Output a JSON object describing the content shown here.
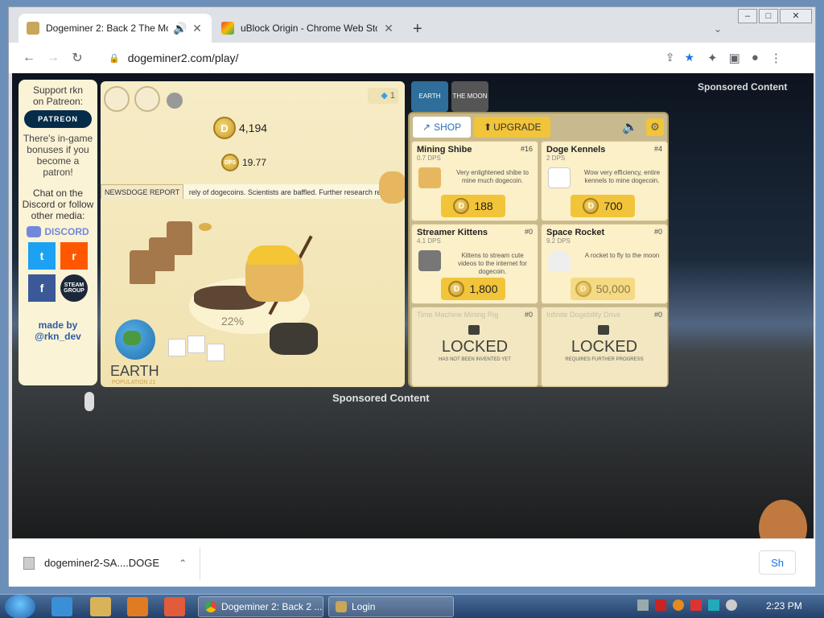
{
  "browser": {
    "tabs": [
      {
        "title": "Dogeminer 2: Back 2 The Moon",
        "active": true
      },
      {
        "title": "uBlock Origin - Chrome Web Store",
        "active": false
      }
    ],
    "url": "dogeminer2.com/play/",
    "window_controls": {
      "min": "–",
      "max": "□",
      "close": "✕"
    }
  },
  "page": {
    "sponsored_top": "Sponsored Content",
    "sponsored_bottom": "Sponsored Content"
  },
  "social": {
    "support_line1": "Support rkn",
    "support_line2": "on Patreon:",
    "patreon_label": "PATREON",
    "theres_text": "There's in-game bonuses if you become a patron!",
    "chat_text": "Chat on the Discord or follow other media:",
    "discord_label": "DISCORD",
    "steam_label": "STEAM GROUP",
    "made_by": "made by",
    "handle": "@rkn_dev"
  },
  "game": {
    "coins": "4,194",
    "dps_label": "DPS",
    "dps": "19.77",
    "gems": "1",
    "news_label": "NEWSDOGE REPORT",
    "news_text": "rely of dogecoins. Scientists are baffled. Further research required. N",
    "progress": "22%",
    "planet_name": "EARTH",
    "planet_sub": "POPULATION 21",
    "world_tabs": [
      "EARTH",
      "THE MOON"
    ]
  },
  "shop": {
    "tab_shop": "SHOP",
    "tab_upgrade": "UPGRADE",
    "items": [
      {
        "name": "Mining Shibe",
        "dps": "0.7 DPS",
        "count": "#16",
        "desc": "Very enlightened shibe to mine much dogecoin.",
        "price": "188",
        "affordable": true
      },
      {
        "name": "Doge Kennels",
        "dps": "2 DPS",
        "count": "#4",
        "desc": "Wow very efficiency, entire kennels to mine dogecoin.",
        "price": "700",
        "affordable": true
      },
      {
        "name": "Streamer Kittens",
        "dps": "4.1 DPS",
        "count": "#0",
        "desc": "Kittens to stream cute videos to the internet for dogecoin.",
        "price": "1,800",
        "affordable": true
      },
      {
        "name": "Space Rocket",
        "dps": "9.2 DPS",
        "count": "#0",
        "desc": "A rocket to fly to the moon",
        "price": "50,000",
        "affordable": false
      }
    ],
    "locked": [
      {
        "faint": "Time Machine Mining Rig",
        "count": "#0",
        "title": "LOCKED",
        "sub": "HAS NOT BEEN INVENTED YET"
      },
      {
        "faint": "Infinite Dogebility Drive",
        "count": "#0",
        "title": "LOCKED",
        "sub": "REQUIRES FURTHER PROGRESS"
      }
    ]
  },
  "downloads": {
    "file": "dogeminer2-SA....DOGE",
    "show_all": "Sh"
  },
  "taskbar": {
    "buttons": [
      "Dogeminer 2: Back 2 ...",
      "Login"
    ],
    "clock": "2:23 PM"
  },
  "colors": {
    "accent_yellow": "#f2c43a",
    "shop_blue": "#2a6fb8",
    "patreon_navy": "#052d49",
    "discord": "#7289da"
  }
}
